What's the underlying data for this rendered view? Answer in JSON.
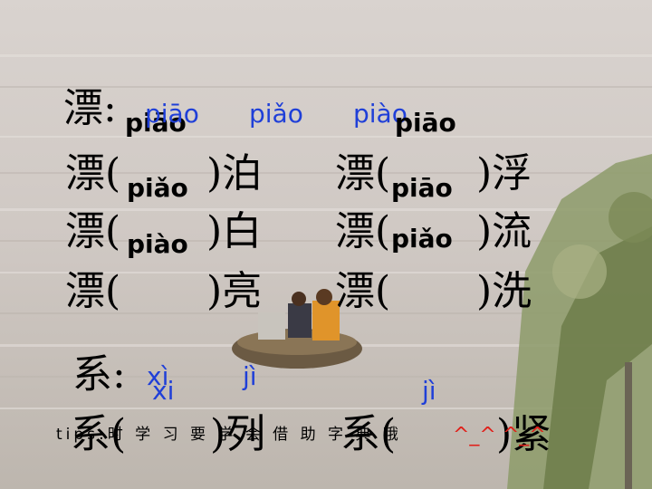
{
  "slide": {
    "piao_header": {
      "char": "漂:",
      "pinyin_main": "piāo",
      "options": [
        "piāo",
        "piǎo",
        "piào"
      ],
      "pinyin_right": "piāo"
    },
    "rows": [
      {
        "left_char": "漂(",
        "left_pinyin": "piǎo",
        "left_tail": ")泊",
        "right_char": "漂(",
        "right_pinyin": "piāo",
        "right_tail": ")浮"
      },
      {
        "left_char": "漂(",
        "left_pinyin": "piào",
        "left_tail": ")白",
        "right_char": "漂(",
        "right_pinyin": "piǎo",
        "right_tail": ")流"
      },
      {
        "left_char": "漂(",
        "left_pinyin": "",
        "left_tail": ")亮",
        "right_char": "漂(",
        "right_pinyin": "",
        "right_tail": ")洗"
      }
    ],
    "xi_header": {
      "char": "系:",
      "options": [
        "xì",
        "jì",
        "jì"
      ],
      "pinyin_main": "xi"
    },
    "xi_row": {
      "left_char": "系(",
      "left_tail": ")列",
      "right_char": "系(",
      "right_tail": ")紧"
    },
    "tip": "tips:时 学 习 要 学 会 借 助 字 典 哦",
    "smiley": "^_^ ^_^",
    "colors": {
      "blue": "#1f3fd8",
      "red": "#e0201a"
    }
  }
}
